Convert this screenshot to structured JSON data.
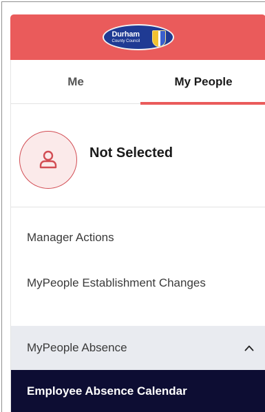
{
  "header": {
    "logo_main": "Durham",
    "logo_sub": "County Council",
    "brand_color": "#ea5b5b"
  },
  "tabs": [
    {
      "label": "Me",
      "active": false
    },
    {
      "label": "My People",
      "active": true
    }
  ],
  "profile": {
    "name": "Not Selected",
    "icon": "user-icon"
  },
  "menu": {
    "items": [
      {
        "label": "Manager Actions"
      },
      {
        "label": "MyPeople Establishment Changes"
      }
    ],
    "group": {
      "label": "MyPeople Absence",
      "expanded": true,
      "icon": "chevron-up-icon",
      "children": [
        {
          "label": "Employee Absence Calendar",
          "selected": true
        }
      ]
    }
  }
}
